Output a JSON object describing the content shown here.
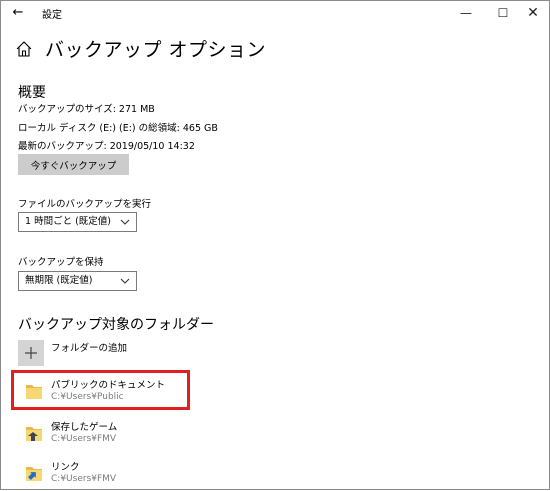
{
  "window": {
    "title": "設定",
    "back_glyph": "←",
    "minimize_glyph": "—",
    "maximize_glyph": "☐",
    "close_glyph": "✕"
  },
  "page": {
    "title": "バックアップ オプション"
  },
  "overview": {
    "heading": "概要",
    "backup_size": "バックアップのサイズ: 271 MB",
    "disk_total": "ローカル ディスク (E:) (E:) の総領域: 465 GB",
    "latest_backup": "最新のバックアップ: 2019/05/10 14:32",
    "backup_now_button": "今すぐバックアップ"
  },
  "schedule": {
    "label": "ファイルのバックアップを実行",
    "selected": "1 時間ごと (既定値)"
  },
  "retention": {
    "label": "バックアップを保持",
    "selected": "無期限 (既定値)"
  },
  "folders": {
    "heading": "バックアップ対象のフォルダー",
    "add_label": "フォルダーの追加",
    "items": [
      {
        "name": "パブリックのドキュメント",
        "path": "C:¥Users¥Public",
        "icon": "folder-icon"
      },
      {
        "name": "保存したゲーム",
        "path": "C:¥Users¥FMV",
        "icon": "saved-games-icon"
      },
      {
        "name": "リンク",
        "path": "C:¥Users¥FMV",
        "icon": "links-folder-icon"
      }
    ]
  },
  "colors": {
    "highlight": "#e0201e",
    "button_bg": "#cccccc",
    "folder_yellow": "#f4c95d",
    "secondary_text": "#7a7a7a"
  }
}
